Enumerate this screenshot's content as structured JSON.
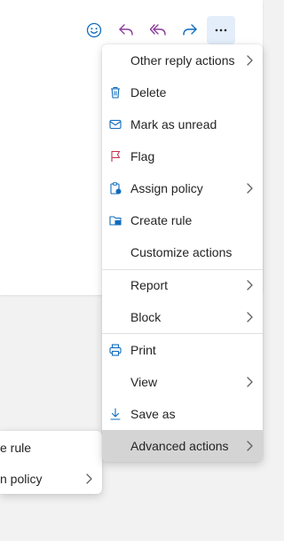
{
  "toolbar": {
    "buttons": [
      {
        "name": "emoji-reaction",
        "icon": "smile-icon"
      },
      {
        "name": "reply",
        "icon": "reply-icon"
      },
      {
        "name": "reply-all",
        "icon": "reply-all-icon"
      },
      {
        "name": "forward",
        "icon": "forward-icon"
      },
      {
        "name": "more-actions",
        "icon": "more-horizontal-icon",
        "label": "···"
      }
    ]
  },
  "menu": {
    "items": [
      {
        "label": "Other reply actions",
        "icon": null,
        "submenu": true
      },
      {
        "label": "Delete",
        "icon": "delete-icon",
        "submenu": false
      },
      {
        "label": "Mark as unread",
        "icon": "envelope-icon",
        "submenu": false
      },
      {
        "label": "Flag",
        "icon": "flag-icon",
        "submenu": false
      },
      {
        "label": "Assign policy",
        "icon": "policy-icon",
        "submenu": true
      },
      {
        "label": "Create rule",
        "icon": "folder-rule-icon",
        "submenu": false
      },
      {
        "label": "Customize actions",
        "icon": null,
        "submenu": false
      },
      {
        "label": "Report",
        "icon": null,
        "submenu": true
      },
      {
        "label": "Block",
        "icon": null,
        "submenu": true
      },
      {
        "label": "Print",
        "icon": "print-icon",
        "submenu": false
      },
      {
        "label": "View",
        "icon": null,
        "submenu": true
      },
      {
        "label": "Save as",
        "icon": "download-icon",
        "submenu": false
      },
      {
        "label": "Advanced actions",
        "icon": null,
        "submenu": true,
        "hovered": true
      }
    ]
  },
  "submenu": {
    "items": [
      {
        "label": "e rule",
        "submenu": false
      },
      {
        "label": "n policy",
        "submenu": true
      }
    ]
  },
  "colors": {
    "accent": "#0f6cbd",
    "toolbar_icon": "#8a3c9c",
    "flag": "#c4314b",
    "hover": "#d4d4d4",
    "background": "#f2f2f2"
  }
}
